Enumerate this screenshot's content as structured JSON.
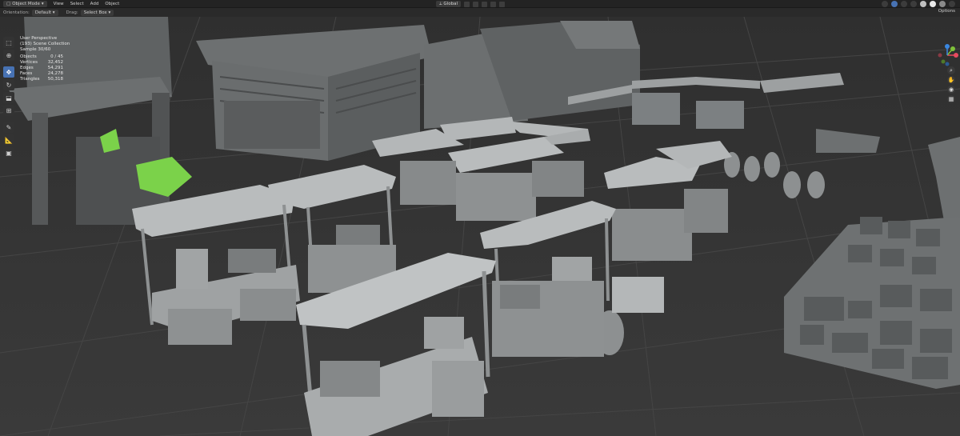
{
  "header": {
    "mode": "Object Mode",
    "menus": [
      "View",
      "Select",
      "Add",
      "Object"
    ],
    "transform_orientation": "Global"
  },
  "subheader": {
    "orientation_label": "Orientation:",
    "orientation_value": "Default",
    "drag_label": "Drag:",
    "drag_value": "Select Box",
    "options": "Options"
  },
  "overlay": {
    "view": "User Perspective",
    "collection": "(193) Scene Collection",
    "sample": "Sample 30/60",
    "stats": [
      {
        "k": "Objects",
        "v": "0 / 45"
      },
      {
        "k": "Vertices",
        "v": "32,452"
      },
      {
        "k": "Edges",
        "v": "54,291"
      },
      {
        "k": "Faces",
        "v": "24,278"
      },
      {
        "k": "Triangles",
        "v": "50,318"
      }
    ]
  },
  "toolbar": {
    "tools": [
      {
        "icon": "select-box-icon",
        "glyph": "⬚",
        "active": false
      },
      {
        "icon": "cursor-icon",
        "glyph": "⊕",
        "active": false
      },
      {
        "icon": "move-icon",
        "glyph": "✥",
        "active": true
      },
      {
        "icon": "rotate-icon",
        "glyph": "↻",
        "active": false
      },
      {
        "icon": "scale-icon",
        "glyph": "⬓",
        "active": false
      },
      {
        "icon": "transform-icon",
        "glyph": "⊞",
        "active": false
      },
      {
        "icon": "annotate-icon",
        "glyph": "✎",
        "active": false
      },
      {
        "icon": "measure-icon",
        "glyph": "📐",
        "active": false
      },
      {
        "icon": "add-cube-icon",
        "glyph": "▣",
        "active": false
      }
    ]
  },
  "gizmo": {
    "x_color": "#e84a5f",
    "y_color": "#7fc23a",
    "z_color": "#3a87e0"
  },
  "colors": {
    "accent": "#4772b3",
    "ground": "#3a3a3a",
    "grid": "#474747",
    "model": "#a9acad",
    "model_dark": "#7c8082",
    "leaves": "#7bd24a"
  }
}
